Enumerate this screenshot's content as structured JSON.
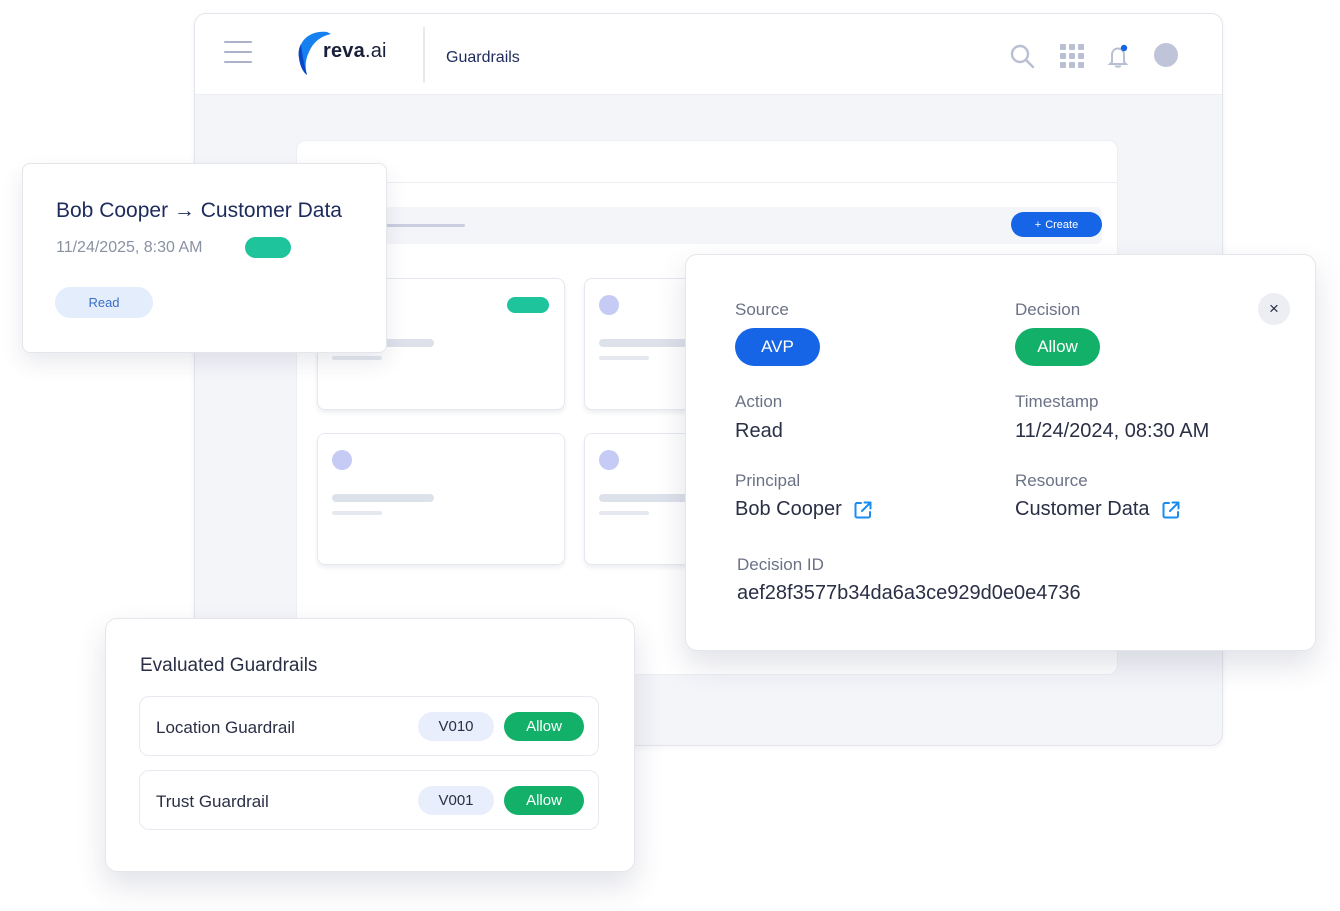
{
  "header": {
    "logo_main": "reva",
    "logo_suffix": ".ai",
    "title": "Guardrails"
  },
  "toolbar": {
    "create_label": "Create",
    "create_icon": "+"
  },
  "icons": {
    "search": "search-icon",
    "apps": "grid-icon",
    "notifications": "bell-icon",
    "external_link": "external-link-icon",
    "close": "close-icon"
  },
  "event_card": {
    "title": "Bob Cooper → Customer Data",
    "timestamp": "11/24/2025, 8:30 AM",
    "action": "Read"
  },
  "detail": {
    "close_symbol": "×",
    "source_label": "Source",
    "source_value": "AVP",
    "decision_label": "Decision",
    "decision_value": "Allow",
    "action_label": "Action",
    "action_value": "Read",
    "timestamp_label": "Timestamp",
    "timestamp_value": "11/24/2024, 08:30 AM",
    "principal_label": "Principal",
    "principal_value": "Bob Cooper",
    "resource_label": "Resource",
    "resource_value": "Customer Data",
    "decision_id_label": "Decision ID",
    "decision_id_value": "aef28f3577b34da6a3ce929d0e0e4736"
  },
  "guardrails": {
    "title": "Evaluated Guardrails",
    "rows": [
      {
        "name": "Location Guardrail",
        "version": "V010",
        "status": "Allow"
      },
      {
        "name": "Trust Guardrail",
        "version": "V001",
        "status": "Allow"
      }
    ]
  },
  "colors": {
    "primary": "#1565e6",
    "success": "#12b068",
    "teal": "#1ec49c",
    "navy": "#1d2a5c"
  }
}
